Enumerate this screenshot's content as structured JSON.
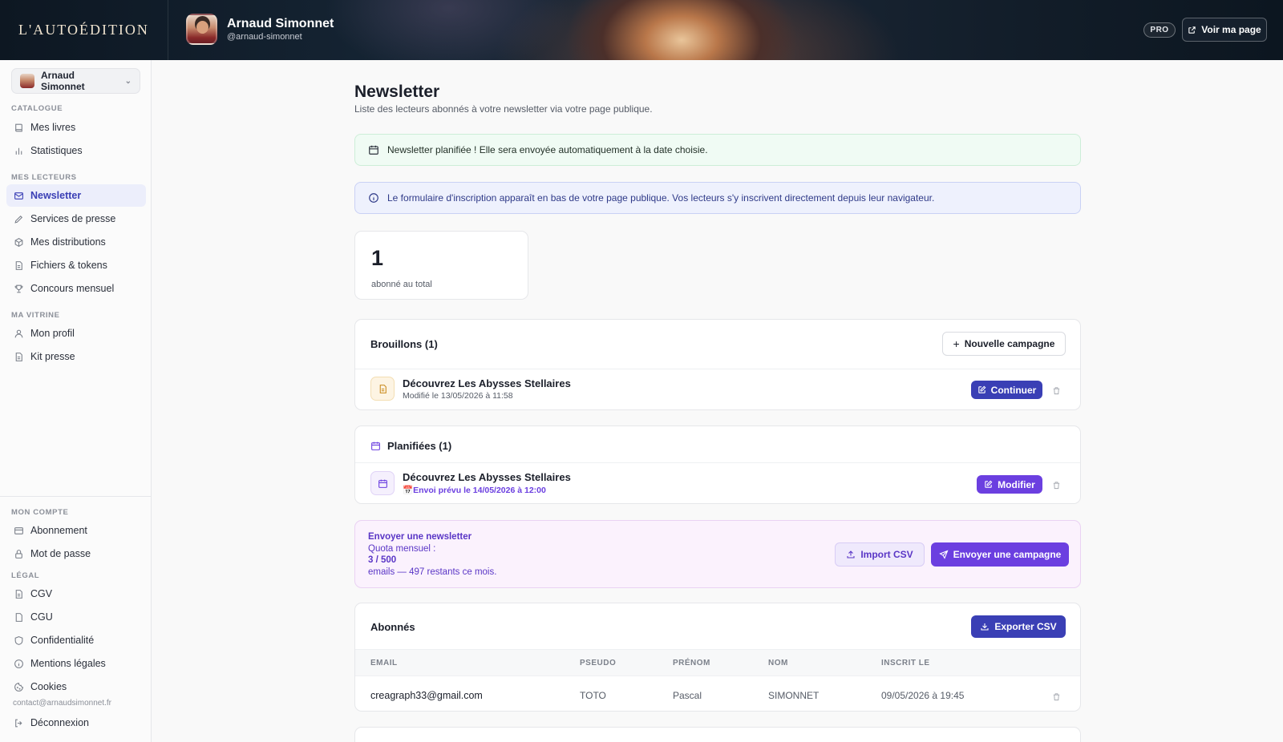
{
  "app": {
    "brand": "L'AUTOÉDITION",
    "user_name": "Arnaud Simonnet",
    "user_handle": "@arnaud-simonnet",
    "plan_badge": "PRO",
    "view_page_label": "Voir ma page"
  },
  "sidebar": {
    "account_name": "Arnaud Simonnet",
    "sections": {
      "catalogue": "CATALOGUE",
      "lecteurs": "MES LECTEURS",
      "vitrine": "MA VITRINE",
      "compte": "MON COMPTE",
      "legal": "LÉGAL"
    },
    "items": {
      "mes_livres": "Mes livres",
      "statistiques": "Statistiques",
      "newsletter": "Newsletter",
      "services_presse": "Services de presse",
      "distributions": "Mes distributions",
      "fichiers": "Fichiers & tokens",
      "concours": "Concours mensuel",
      "profil": "Mon profil",
      "kit_presse": "Kit presse",
      "abonnement": "Abonnement",
      "mot_de_passe": "Mot de passe",
      "cgv": "CGV",
      "cgu": "CGU",
      "confidentialite": "Confidentialité",
      "mentions": "Mentions légales",
      "cookies": "Cookies",
      "deconnexion": "Déconnexion"
    },
    "contact_email": "contact@arnaudsimonnet.fr"
  },
  "page": {
    "title": "Newsletter",
    "subtitle": "Liste des lecteurs abonnés à votre newsletter via votre page publique."
  },
  "alerts": {
    "success": "Newsletter planifiée ! Elle sera envoyée automatiquement à la date choisie.",
    "info": "Le formulaire d'inscription apparaît en bas de votre page publique. Vos lecteurs s'y inscrivent directement depuis leur navigateur."
  },
  "stats": {
    "subscriber_count": "1",
    "subscriber_label": "abonné au total"
  },
  "drafts": {
    "title": "Brouillons (1)",
    "new_campaign_label": "Nouvelle campagne",
    "items": [
      {
        "title": "Découvrez Les Abysses Stellaires",
        "meta": "Modifié le 13/05/2026 à 11:58",
        "action": "Continuer"
      }
    ]
  },
  "scheduled": {
    "title": "Planifiées (1)",
    "items": [
      {
        "title": "Découvrez Les Abysses Stellaires",
        "meta": "Envoi prévu le 14/05/2026 à 12:00",
        "action": "Modifier"
      }
    ]
  },
  "send_panel": {
    "title": "Envoyer une newsletter",
    "quota_label": "Quota mensuel :",
    "quota_value": "3 / 500",
    "remaining": "emails — 497 restants ce mois.",
    "import_label": "Import CSV",
    "send_label": "Envoyer une campagne"
  },
  "subscribers": {
    "title": "Abonnés",
    "export_label": "Exporter CSV",
    "columns": [
      "EMAIL",
      "PSEUDO",
      "PRÉNOM",
      "NOM",
      "INSCRIT LE"
    ],
    "rows": [
      {
        "email": "creagraph33@gmail.com",
        "pseudo": "TOTO",
        "prenom": "Pascal",
        "nom": "SIMONNET",
        "inscrit": "09/05/2026 à 19:45"
      }
    ]
  },
  "colors": {
    "accent": "#3a3fb5",
    "violet": "#6b3fe0",
    "success_bg": "#f0fbf4",
    "info_bg": "#eef1fd"
  }
}
